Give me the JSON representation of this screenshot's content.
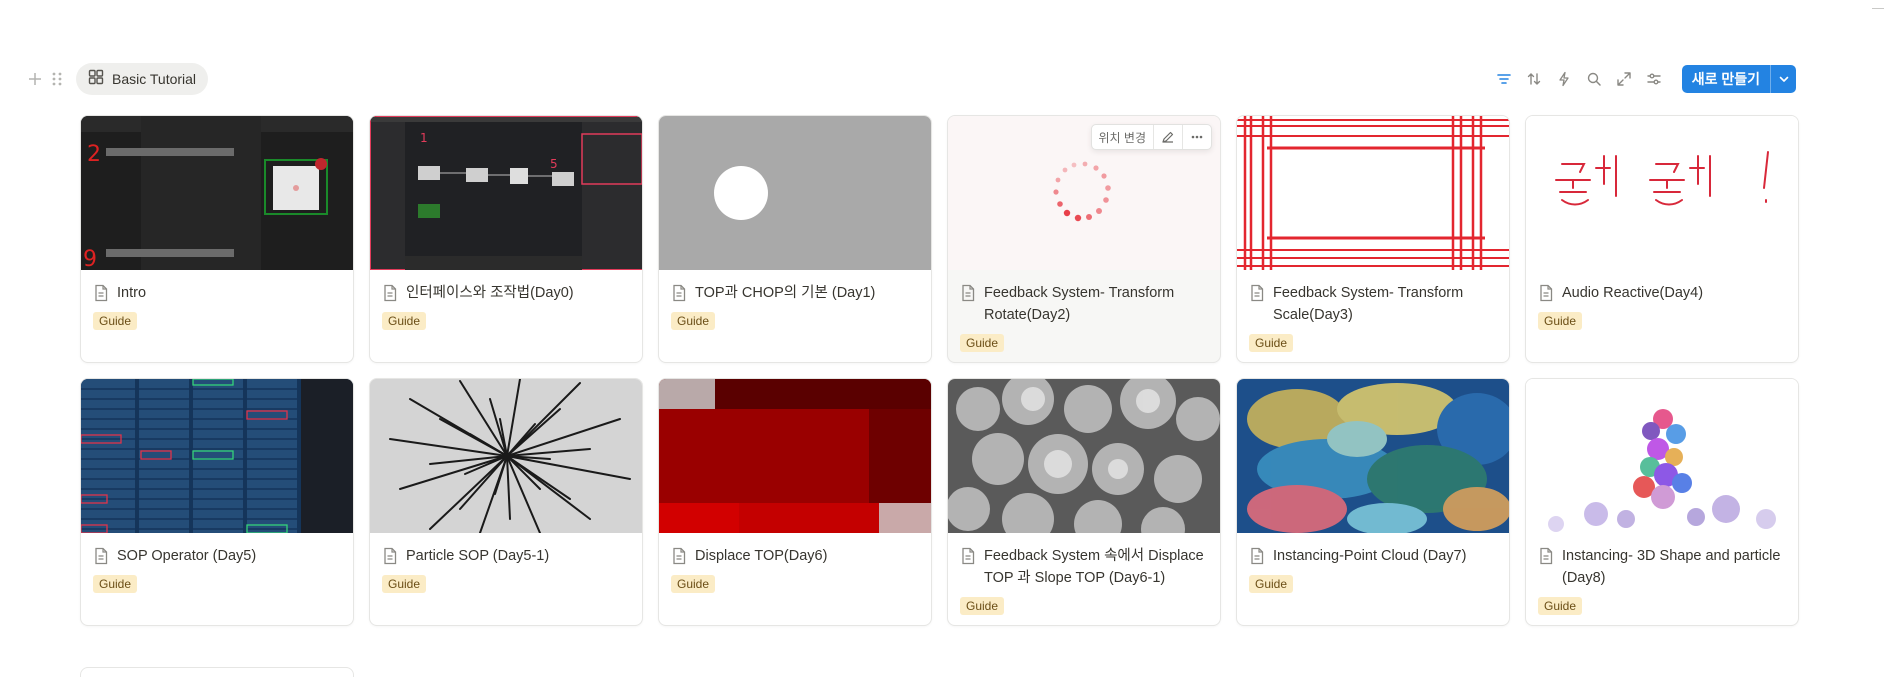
{
  "toolbar": {
    "view_tab_label": "Basic Tutorial",
    "new_button_label": "새로 만들기",
    "accent": "#2383e2"
  },
  "card_actions": {
    "move_label": "위치 변경"
  },
  "cards": [
    {
      "title": "Intro",
      "tag": "Guide"
    },
    {
      "title": "인터페이스와 조작법(Day0)",
      "tag": "Guide"
    },
    {
      "title": "TOP과 CHOP의 기본 (Day1)",
      "tag": "Guide"
    },
    {
      "title": "Feedback System- Transform Rotate(Day2)",
      "tag": "Guide"
    },
    {
      "title": "Feedback System- Transform Scale(Day3)",
      "tag": "Guide"
    },
    {
      "title": "Audio Reactive(Day4)",
      "tag": "Guide"
    },
    {
      "title": "SOP Operator (Day5)",
      "tag": "Guide"
    },
    {
      "title": "Particle SOP (Day5-1)",
      "tag": "Guide"
    },
    {
      "title": "Displace TOP(Day6)",
      "tag": "Guide"
    },
    {
      "title": "Feedback System 속에서 Displace TOP 과 Slope TOP (Day6-1)",
      "tag": "Guide"
    },
    {
      "title": "Instancing-Point Cloud (Day7)",
      "tag": "Guide"
    },
    {
      "title": "Instancing- 3D Shape and particle (Day8)",
      "tag": "Guide"
    }
  ],
  "colors": {
    "tag_bg": "#fbecc6",
    "tag_text": "#6b4e16",
    "border": "#e6e6e4"
  }
}
